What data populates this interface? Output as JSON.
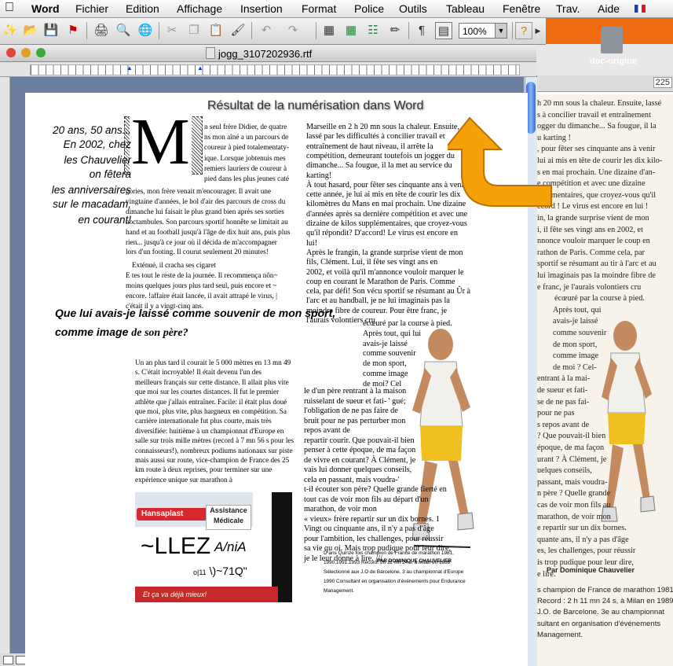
{
  "menubar": {
    "app": "Word",
    "items": [
      "Fichier",
      "Edition",
      "Affichage",
      "Insertion",
      "Format",
      "Police",
      "Outils",
      "Tableau",
      "Fenêtre",
      "Trav.",
      "Aide"
    ]
  },
  "toolbar": {
    "zoom": "100%"
  },
  "window": {
    "title": "jogg_3107202936.rtf"
  },
  "desktop": {
    "icon_label": "doc-origine",
    "orig_number": "225",
    "scan_lines": [
      "h 20 mn sous la chaleur. Ensuite, lassé",
      "s à concilier travail et entraînement",
      "ogger du dimanche... Sa fougue, il la",
      "u karting !",
      ", pour fêter ses cinquante ans à venir",
      "lui ai mis en tête de courir les dix kilo-",
      "s en mai prochain. Une dizaine d'an-",
      "e compétition et avec une dizaine",
      "pplémentaires, que croyez-vous qu'il",
      "ccord ! Le virus est encore en lui !",
      "in, la grande surprise vient de mon",
      "i, il fête ses vingt ans en 2002, et",
      "nnonce vouloir marquer le coup en",
      "rathon de Paris. Comme cela, par",
      "sportif se résumant au tir à l'arc et au",
      "lui imaginais pas la moindre fibre de",
      "e franc, je l'aurais volontiers cru",
      "écœuré par la course à pied.",
      "Après tout, qui",
      "avais-je laissé",
      "comme souvenir",
      "de mon sport,",
      "comme image",
      "de moi ? Cel-",
      "entrant à la mai-",
      "de sueur et fati-",
      "se de ne pas fai-",
      "pour ne pas",
      "s repos avant de",
      "? Que pouvait-il bien",
      "époque, de ma façon",
      "urant ? À Clément, je",
      "uelques conseils,",
      "passant, mais voudra-",
      "n père ? Quelle grande",
      "cas de voir mon fils au",
      "marathon, de voir mon",
      "e repartir sur un dix bornes.",
      "quante ans, il n'y a pas d'âge",
      "es, les challenges, pour réussir",
      "is trop pudique pour leur dire,",
      "e lire."
    ],
    "scan_signature": "Par Dominique Chauvelier",
    "scan_footer": [
      "s champion de France de marathon 1981,",
      "Record : 2 h 11 mn 24 s, à Milan en 1989.",
      "J.O. de Barcelone. 3e au championnat",
      "sultant en organisation d'événements",
      "Management."
    ]
  },
  "doc": {
    "overlay_caption": "Résultat de la numérisation dans Word",
    "intro_lines": [
      "20 ans, 50 ans...",
      "En 2002, chez",
      "les Chauvelier",
      "on fêtera",
      "les anniversaires",
      "sur le macadam,",
      "en courant!"
    ],
    "dropcap": "M",
    "col1_top": [
      "n seul frère Didier, de quatre",
      "ns mon aîné a un parcours de",
      "coureur à pied totalementaty-",
      "ique. Lorsque jobtenuis mes",
      "remiers lauriers de coureur à",
      "pied dans les plus jeunes caté",
      "gories, mon frère venait m'encourager. Il avait une",
      "vingtaine d'années, le bol d'air des parcours de cross du",
      "dimanche lui faisait le plus grand bien après ses sorties",
      "noctambules. Son parcours sportif honnête se limitait au",
      "hand et au football jusqu'à l'âge de dix huit ans, puis plus",
      "rien... jusqu'à ce jour où il décida de m'accompagner",
      "lors d'un footing. Il courut seulement 20 minutes!",
      "Exténué, il cracha ses cigaret",
      "E tes tout le reste de la journée. Il recommença nôn~",
      "moins quelques jours plus tard seul, puis encore et ~",
      "encore. !affaire était lancée, il avait attrapé le virus, |",
      "c'était il y a vingt-cinq ans."
    ],
    "heading": [
      "Que lui avais-je laissé comme souvenir de mon sport,",
      "comme image",
      "de son père?"
    ],
    "col1_bottom": [
      "Un an plus tard il courait le 5 000 mètres en 13 mn 49",
      "s. C'était incroyable! Il était devenu l'un des",
      "meilleurs français sur cette distance. Il allait plus vite",
      "que moi sur les courtes distances. Il fut le premier",
      "athlète que j'allais entraîner. Facile: il était plus doué",
      "que moi, plus vite, plus hargneux en compétition. Sa",
      "carrière internationale fut plus courte, mais très",
      "diversifiée: huitième à un championnat d'Europe en",
      "salle sur trois mille mètres (record à 7 mn 56 s pour les",
      "connaisseurs!), nombreux podiums nationaux sur piste",
      "mais aussi sur route, vice-champion de France des 25",
      "km route à deux reprises, pour terminer sur une",
      "expérience unique sur marathon à"
    ],
    "col2_top": [
      "Marseille en 2 h 20 mn sous la chaleur. Ensuite,",
      "lassé par les difficultés à concilier travail et",
      "entraînement de haut niveau, il arrête la",
      "compétition, demeurant toutefois un jogger du",
      "dimanche... Sa fougue, il la met au service du",
      "karting!",
      "À tout hasard, pour fêter ses cinquante ans à venir",
      "cette année, je lui ai mis en tête de courir les dix",
      "kilomètres du Mans en mai prochain. Une dizaine",
      "d'années après sa dernière compétition et avec une",
      "dizaine de kilos supplémentaires, que croyez-vous",
      "qu'il répondit? D'accord! Le virus est encore en",
      "lui!",
      "Après le frangin, la grande surprise vient de mon",
      "fils, Clément. Lui, il fête ses vingt ans en",
      "2002, et voilà qu'il m'annonce vouloir marquer le",
      "coup en courant le Marathon de Paris. Comme",
      "cela, par défi! Son vécu sportif se résumant au Ûr à",
      "l'arc et au handball, je ne lui imaginais pas la",
      "moindre fibre de coureur. Pour être franc, je",
      "l'aurais volontiers cru"
    ],
    "col2_narrow": [
      "écœuré par la course à pied.",
      "Après tout, qui lui",
      "avais-je laissé",
      "comme souvenir",
      "de mon sport,",
      "comme image",
      "de moi? Cel"
    ],
    "col2_bottom": [
      "le d'un père rentrant à la maison",
      "ruisselant de sueur et fati- ' gué;",
      "l'obligation de ne pas faire de",
      "bruit pour ne pas perturber mon",
      "repos avant de",
      "repartir courir. Que pouvait-il bien",
      "penser à cette époque, de ma façon",
      "de vivre en courant? À Clément, je",
      "vais lui donner quelques conseils,",
      "cela en passant, mais voudra-'",
      "t-il écouter son père? Quelle grande fierté en",
      "tout cas de voir mon fils au départ d'un",
      "marathon, de voir mon",
      "« vieux» frère repartir sur un dix bornes. 1",
      "Vingt ou cinquante ans, il n'y a pas d'âge",
      "pour l'ambition, les challenges, pour réussir",
      "sa vie qu oi. Mais trop pudique pour leur dire,",
      "je le leur donne à lire. ///"
    ],
    "tiny_lines": [
      "D ans Quinze fois champion de France de marathon 1981,",
      "PAR DOMINIQUE CHAUVELIER",
      "1990,1991,1993 Record: 2h 11 mn 24 s, à Milan en 1989",
      "Sélectionné aux J.O de Barcelone. 3 au championnat d'Europe",
      "1990 Consultant en organisation d'événements pour Endurance",
      "Management."
    ],
    "ad_brand": "Hansaplast",
    "ad_label1": "Assistance",
    "ad_label2": "Médicale",
    "ad_bottom": "Et ça va déjà mieux!",
    "ocr_text1": "~LLEZ",
    "ocr_text2": "A/niA",
    "ocr_text3_small": "o|11",
    "ocr_text3": "\\)~71Q\""
  },
  "colors": {
    "accent_orange": "#f4a10a",
    "desktop_orange": "#f06a10",
    "page_bg": "#6b7ea0"
  }
}
